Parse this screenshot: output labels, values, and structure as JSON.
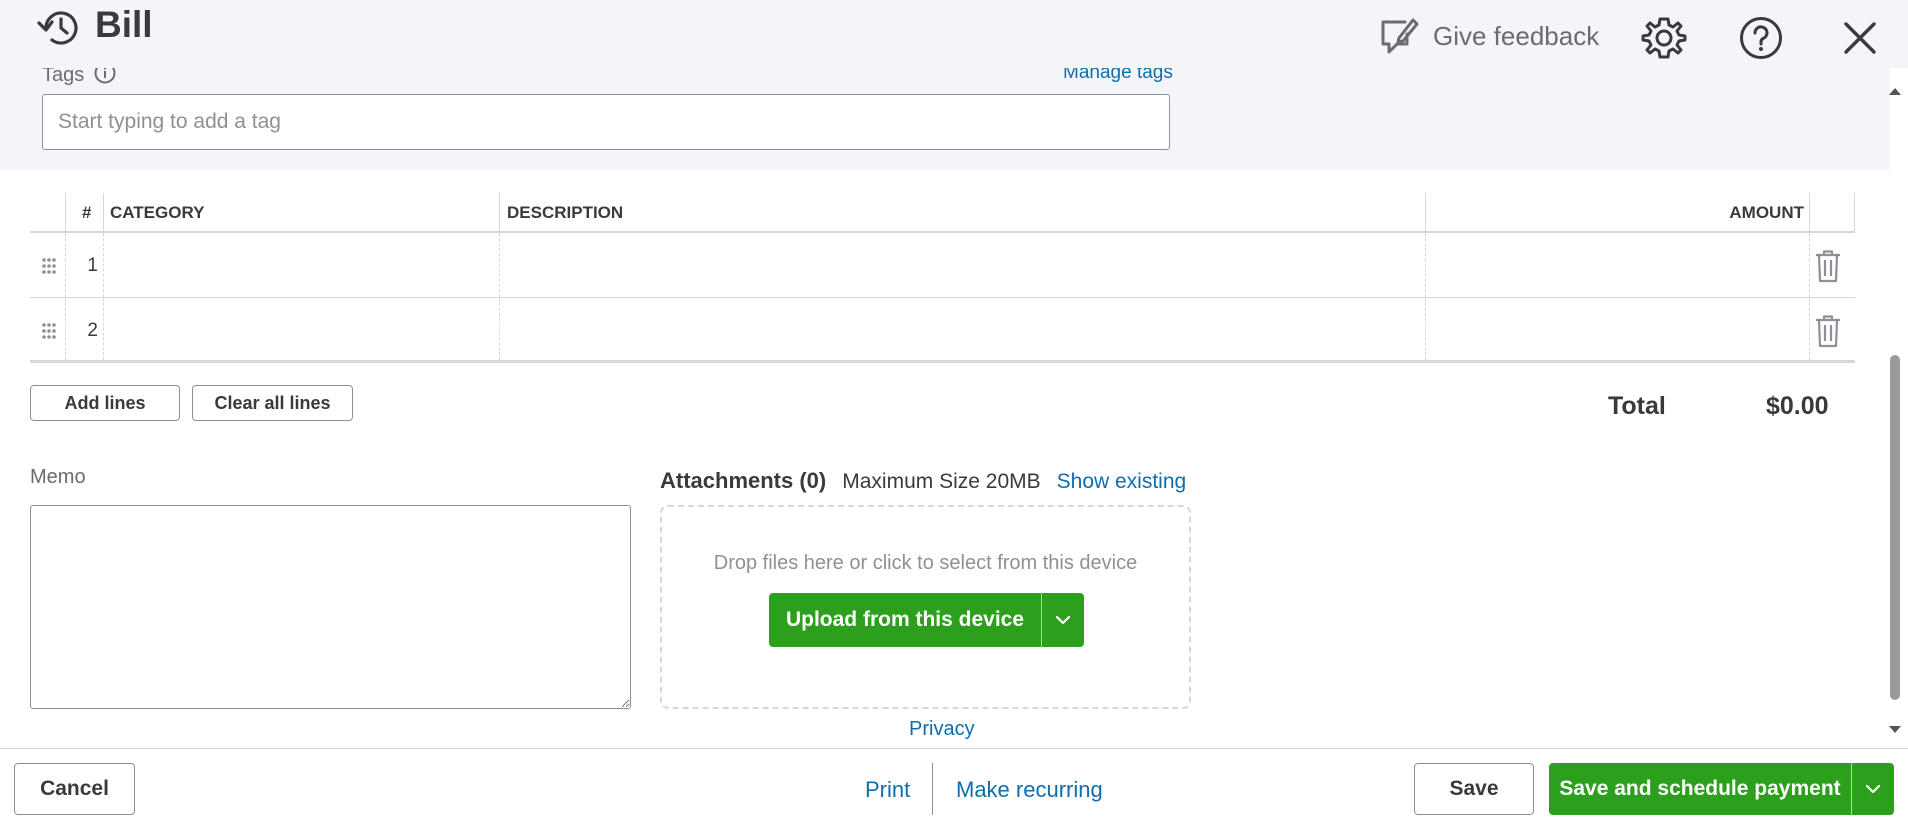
{
  "header": {
    "title": "Bill",
    "feedback_label": "Give feedback",
    "icons": [
      "history-icon",
      "feedback-icon",
      "gear-icon",
      "help-icon",
      "close-icon"
    ]
  },
  "tags": {
    "label": "Tags",
    "manage_label": "Manage tags",
    "placeholder": "Start typing to add a tag"
  },
  "table": {
    "columns": {
      "num": "#",
      "category": "CATEGORY",
      "description": "DESCRIPTION",
      "amount": "AMOUNT"
    },
    "rows": [
      {
        "num": "1"
      },
      {
        "num": "2"
      }
    ]
  },
  "actions": {
    "add_lines": "Add lines",
    "clear_all_lines": "Clear all lines",
    "total_label": "Total",
    "total_value": "$0.00"
  },
  "memo": {
    "label": "Memo",
    "value": ""
  },
  "attachments": {
    "title": "Attachments (0)",
    "max_size": "Maximum Size 20MB",
    "show_existing": "Show existing",
    "drop_hint": "Drop files here or click to select from this device",
    "upload_label": "Upload from this device",
    "privacy": "Privacy"
  },
  "footer": {
    "cancel": "Cancel",
    "print": "Print",
    "make_recurring": "Make recurring",
    "save": "Save",
    "save_and_schedule": "Save and schedule payment"
  },
  "colors": {
    "accent_green": "#2ca01c",
    "link_blue": "#0d6eab",
    "text": "#393a3d",
    "band_bg": "#f4f5f8"
  }
}
